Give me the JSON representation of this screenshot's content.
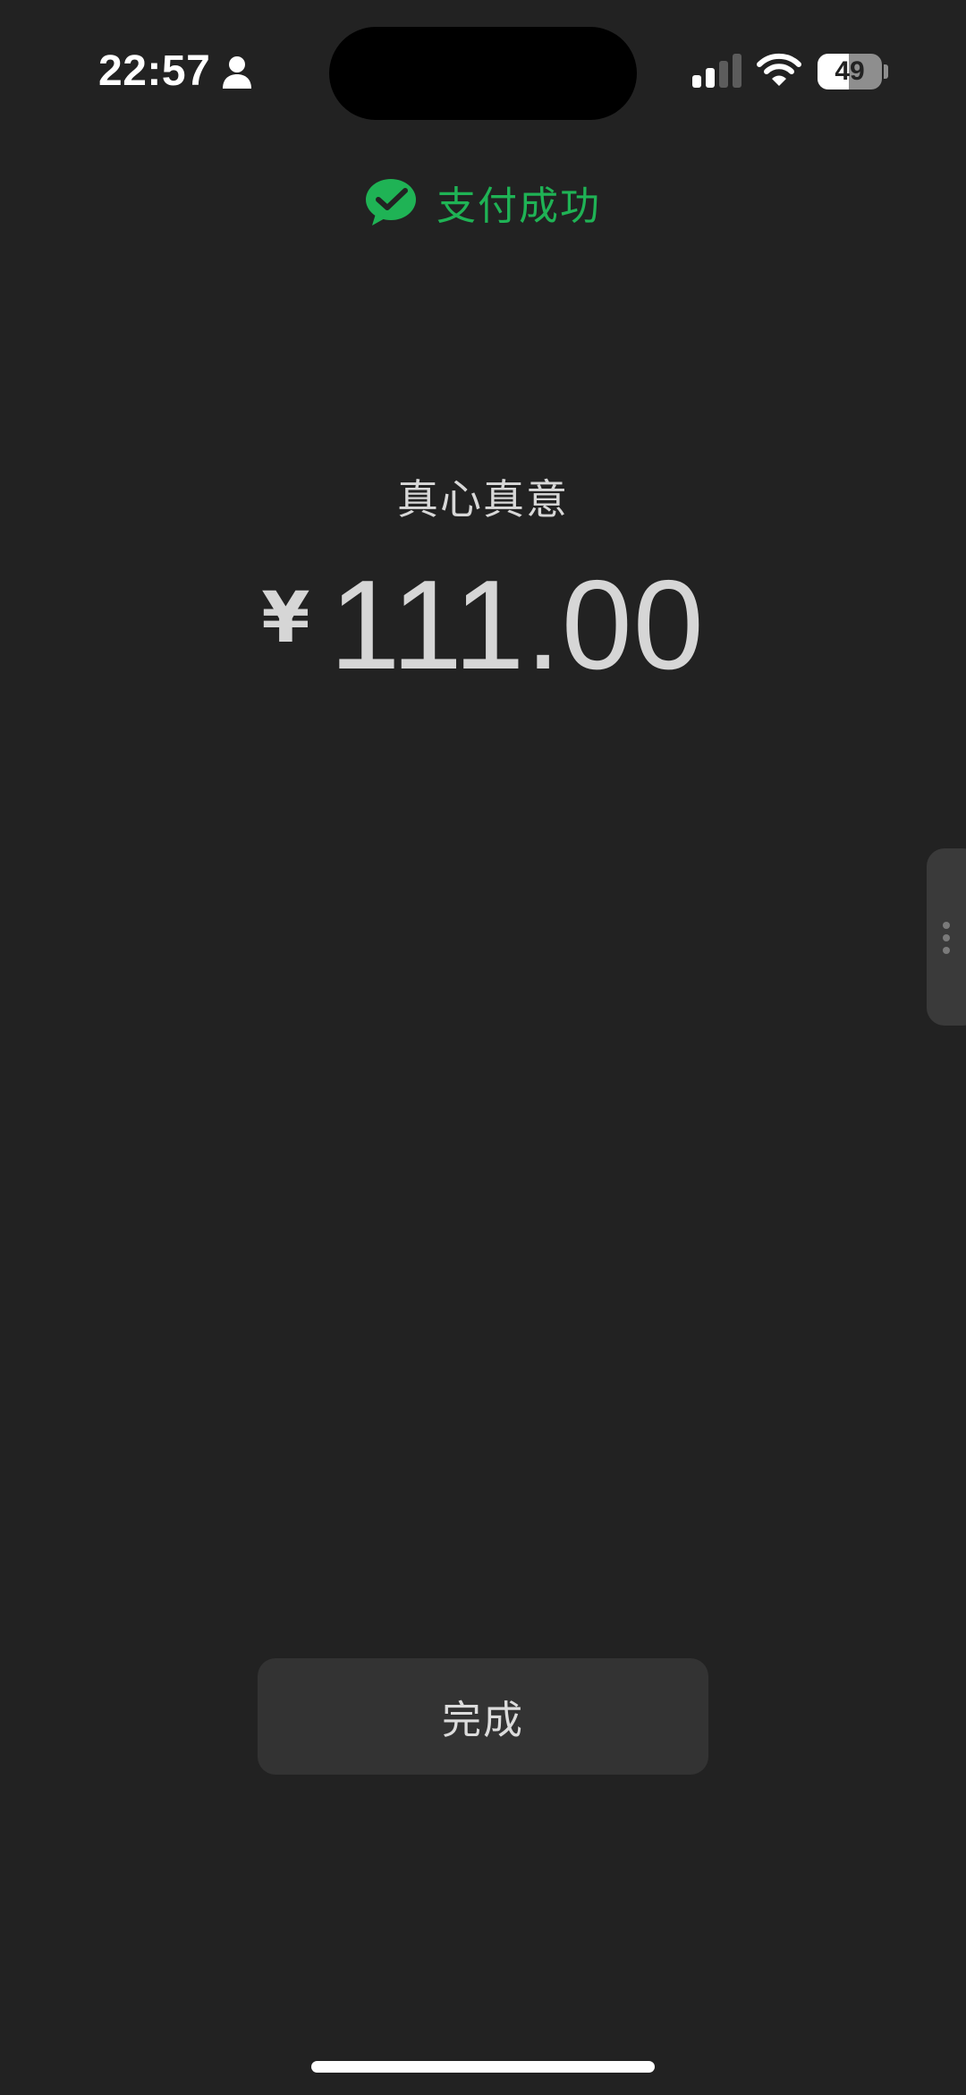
{
  "status_bar": {
    "time": "22:57",
    "battery_level": "49",
    "icons": [
      "person-icon",
      "signal-icon",
      "wifi-icon",
      "battery-icon"
    ]
  },
  "header": {
    "icon": "wechat-pay-icon",
    "status_text": "支付成功"
  },
  "payment": {
    "payee": "真心真意",
    "currency_symbol": "¥",
    "amount": "111.00"
  },
  "actions": {
    "done_label": "完成"
  },
  "colors": {
    "background": "#222222",
    "accent_green": "#1fb355",
    "button": "#333333"
  }
}
